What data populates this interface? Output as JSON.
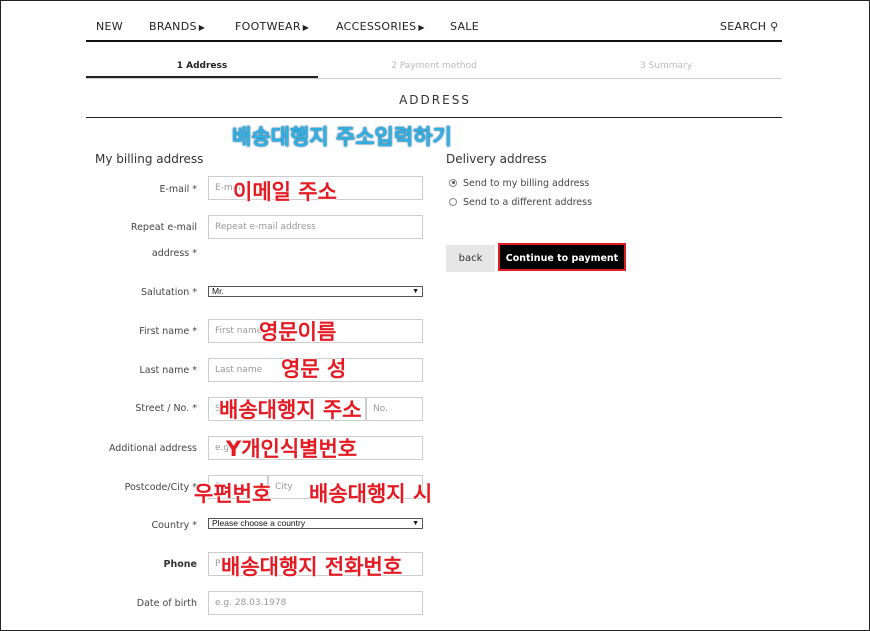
{
  "nav": {
    "new": "NEW",
    "brands": "BRANDS",
    "footwear": "FOOTWEAR",
    "accessories": "ACCESSORIES",
    "sale": "SALE",
    "search": "SEARCH",
    "arrow": "▶",
    "search_icon": "⚲"
  },
  "steps": [
    "1 Address",
    "2 Payment method",
    "3 Summary"
  ],
  "page_title": "ADDRESS",
  "billing": {
    "title": "My billing address",
    "email_label": "E-mail *",
    "email_placeholder": "E-mail",
    "repeat_label_1": "Repeat e-mail",
    "repeat_label_2": "address *",
    "repeat_placeholder": "Repeat e-mail address",
    "salutation_label": "Salutation *",
    "salutation_value": "Mr.",
    "first_label": "First name *",
    "first_placeholder": "First name",
    "last_label": "Last name *",
    "last_placeholder": "Last name",
    "street_label": "Street / No. *",
    "street_placeholder": "St",
    "no_placeholder": "No.",
    "additional_label": "Additional address",
    "additional_placeholder": "e.g.",
    "postcode_label": "Postcode/City *",
    "postcode_placeholder": "P",
    "city_placeholder": "City",
    "country_label": "Country *",
    "country_value": "Please choose a country",
    "phone_label": "Phone",
    "phone_placeholder": "P",
    "dob_label": "Date of birth",
    "dob_placeholder": "e.g. 28.03.1978"
  },
  "delivery": {
    "title": "Delivery address",
    "option1": "Send to my billing address",
    "option2": "Send to a different address",
    "back": "back",
    "continue": "Continue to payment"
  },
  "annotations": {
    "heading": "배송대행지 주소입력하기",
    "email": "이메일 주소",
    "first": "영문이름",
    "last": "영문 성",
    "street": "배송대행지 주소",
    "additional": "Y개인식별번호",
    "postcode": "우편번호",
    "city": "배송대행지 시",
    "phone": "배송대행지 전화번호"
  },
  "colors": {
    "annotation_red": "#e51b23",
    "annotation_blue": "#2fb3e6",
    "button_black": "#000000"
  }
}
